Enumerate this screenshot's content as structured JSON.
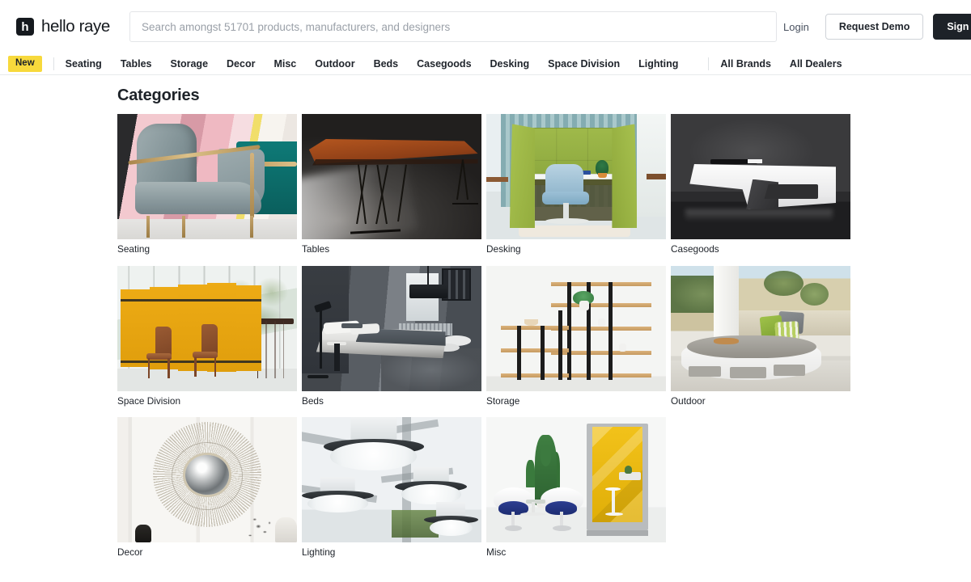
{
  "header": {
    "brand": {
      "logo_glyph": "h",
      "logo_icon_name": "hello-raye-logo-icon",
      "name": "hello raye"
    },
    "search": {
      "placeholder": "Search amongst 51701 products, manufacturers, and designers",
      "value": "",
      "product_count": "51701"
    },
    "login_label": "Login",
    "request_demo_label": "Request Demo",
    "sign_up_label": "Sign Up"
  },
  "nav": {
    "new_badge": "New",
    "new_badge_color": "#f7d93c",
    "categories": [
      "Seating",
      "Tables",
      "Storage",
      "Decor",
      "Misc",
      "Outdoor",
      "Beds",
      "Casegoods",
      "Desking",
      "Space Division",
      "Lighting"
    ],
    "secondary": [
      "All Brands",
      "All Dealers"
    ]
  },
  "main": {
    "title": "Categories",
    "tiles": [
      {
        "label": "Seating",
        "art": "seating"
      },
      {
        "label": "Tables",
        "art": "tables"
      },
      {
        "label": "Desking",
        "art": "desking"
      },
      {
        "label": "Casegoods",
        "art": "casegoods"
      },
      {
        "label": "Space Division",
        "art": "space-division"
      },
      {
        "label": "Beds",
        "art": "beds"
      },
      {
        "label": "Storage",
        "art": "storage"
      },
      {
        "label": "Outdoor",
        "art": "outdoor"
      },
      {
        "label": "Decor",
        "art": "decor"
      },
      {
        "label": "Lighting",
        "art": "lighting"
      },
      {
        "label": "Misc",
        "art": "misc"
      }
    ]
  },
  "colors": {
    "text": "#1d2228",
    "accent_yellow": "#f7d93c",
    "dark_button": "#1d2228",
    "border": "#e3e5e8",
    "placeholder": "#9aa0a8"
  }
}
